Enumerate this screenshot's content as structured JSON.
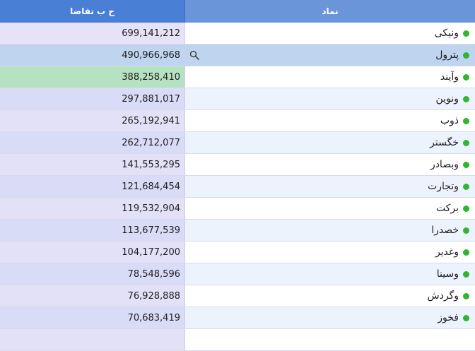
{
  "header": {
    "value_col": "ح ب تقاضا",
    "symbol_col": "نماد"
  },
  "colors": {
    "status_dot": "#2fb52f",
    "selected_row": "#bfd4ef",
    "highlight_value": "#b5e2c0"
  },
  "rows": [
    {
      "symbol": "ونیکی",
      "value": "699,141,212",
      "value_bg": "#e6e3f8",
      "state": "normal"
    },
    {
      "symbol": "پترول",
      "value": "490,966,968",
      "value_bg": "#bfd4ef",
      "state": "selected"
    },
    {
      "symbol": "وآیند",
      "value": "388,258,410",
      "value_bg": "#b5e2c0",
      "state": "highlight"
    },
    {
      "symbol": "ونوین",
      "value": "297,881,017",
      "value_bg": "#d9dcf7",
      "state": "normal"
    },
    {
      "symbol": "ذوب",
      "value": "265,192,941",
      "value_bg": "#e2e1f8",
      "state": "normal"
    },
    {
      "symbol": "خگستر",
      "value": "262,712,077",
      "value_bg": "#d9dcf7",
      "state": "normal"
    },
    {
      "symbol": "وبصادر",
      "value": "141,553,295",
      "value_bg": "#e2e1f8",
      "state": "normal"
    },
    {
      "symbol": "وتجارت",
      "value": "121,684,454",
      "value_bg": "#d9dcf7",
      "state": "normal"
    },
    {
      "symbol": "برکت",
      "value": "119,532,904",
      "value_bg": "#e2e1f8",
      "state": "normal"
    },
    {
      "symbol": "خصدرا",
      "value": "113,677,539",
      "value_bg": "#d9dcf7",
      "state": "normal"
    },
    {
      "symbol": "وغدیر",
      "value": "104,177,200",
      "value_bg": "#e2e1f8",
      "state": "normal"
    },
    {
      "symbol": "وسینا",
      "value": "78,548,596",
      "value_bg": "#d9dcf7",
      "state": "normal"
    },
    {
      "symbol": "وگردش",
      "value": "76,928,888",
      "value_bg": "#e2e1f8",
      "state": "normal"
    },
    {
      "symbol": "فخوز",
      "value": "70,683,419",
      "value_bg": "#d9dcf7",
      "state": "normal"
    },
    {
      "symbol": "",
      "value": "",
      "value_bg": "#e2e1f8",
      "state": "normal"
    }
  ]
}
